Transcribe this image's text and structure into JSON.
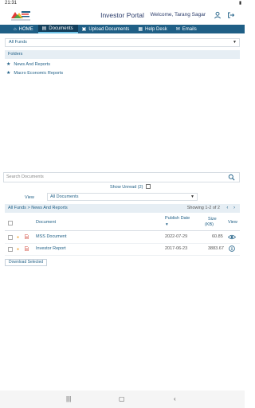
{
  "status_bar": {
    "time": "21:31",
    "battery": "▮"
  },
  "header": {
    "logo_text": "Motilal Oswal",
    "title": "Investor Portal",
    "welcome": "Welcome, Tarang Sagar"
  },
  "nav": {
    "items": [
      {
        "label": "HOME",
        "icon": "home-icon"
      },
      {
        "label": "Documents",
        "icon": "documents-icon"
      },
      {
        "label": "Upload Documents",
        "icon": "upload-icon"
      },
      {
        "label": "Help Desk",
        "icon": "help-desk-icon"
      },
      {
        "label": "Emails",
        "icon": "email-icon"
      }
    ],
    "active": "Documents"
  },
  "funds_select": {
    "value": "All Funds"
  },
  "folders": {
    "heading": "Folders",
    "items": [
      "News And Reports",
      "Macro Economic Reports"
    ]
  },
  "search": {
    "placeholder": "Search Documents"
  },
  "unread": {
    "label": "Show Unread (2)"
  },
  "view": {
    "label": "View",
    "value": "All Documents"
  },
  "crumb": {
    "path_root": "All Funds",
    "separator": ">",
    "path_leaf": "News And Reports",
    "showing": "Showing 1-2 of 2",
    "prev": "‹",
    "next": "›"
  },
  "table": {
    "headers": {
      "document": "Document",
      "publish_date": "Publish Date",
      "sort_arrow": "▾",
      "size": "Size",
      "size_unit": "(KB)",
      "view": "View"
    },
    "rows": [
      {
        "name": "MSS Document",
        "date": "2022-07-29",
        "size": "60.85"
      },
      {
        "name": "Investor Report",
        "date": "2017-06-23",
        "size": "3883.67"
      }
    ]
  },
  "download_button": "Download Selected",
  "colors": {
    "brand": "#1f5f86",
    "nav_active": "#133f5c",
    "accent": "#6cc1e6",
    "star": "#f0a53a"
  }
}
